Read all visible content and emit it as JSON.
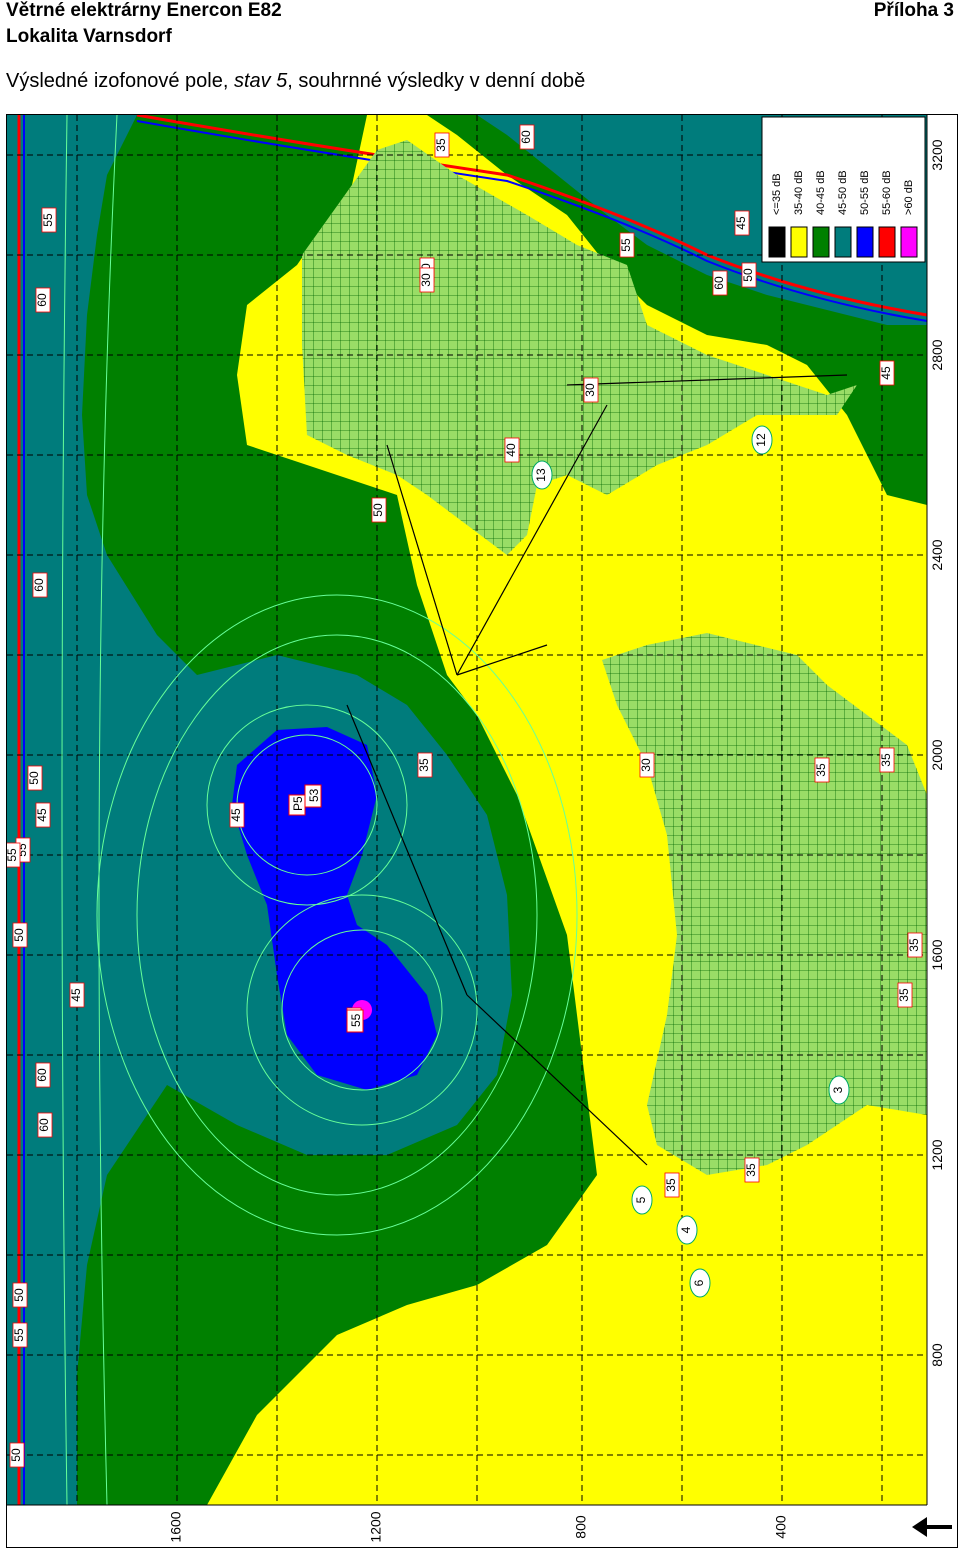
{
  "header": {
    "title_line1": "Větrné elektrárny Enercon E82",
    "title_line2": "Lokalita Varnsdorf",
    "appendix": "Příloha 3",
    "subtitle_prefix": "Výsledné izofonové pole, ",
    "subtitle_italic": "stav 5",
    "subtitle_suffix": ", souhrnné výsledky v denní době"
  },
  "legend": {
    "items": [
      {
        "label": "<=35 dB",
        "color": "#000000"
      },
      {
        "label": "35-40 dB",
        "color": "#ffff00"
      },
      {
        "label": "40-45 dB",
        "color": "#008000"
      },
      {
        "label": "45-50 dB",
        "color": "#007c7c"
      },
      {
        "label": "50-55 dB",
        "color": "#0000ff"
      },
      {
        "label": "55-60 dB",
        "color": "#ff0000"
      },
      {
        "label": ">60 dB",
        "color": "#ff00ff"
      }
    ]
  },
  "axes": {
    "right_ticks": [
      "3200",
      "2800",
      "2400",
      "2000",
      "1600",
      "1200",
      "800"
    ],
    "bottom_ticks": [
      "1600",
      "1200",
      "800",
      "400"
    ]
  },
  "contour_labels": [
    "35",
    "30",
    "60",
    "45",
    "60",
    "50",
    "30",
    "30",
    "40",
    "50",
    "60",
    "50",
    "45",
    "35",
    "30",
    "35",
    "35",
    "50",
    "45",
    "55",
    "55",
    "35",
    "35",
    "35",
    "35",
    "55",
    "60",
    "60",
    "50",
    "55",
    "50",
    "55",
    "60",
    "55",
    "45",
    "45"
  ],
  "receiver_points": [
    "12",
    "13",
    "3",
    "4",
    "5",
    "6"
  ],
  "turbine_labels": [
    "P5",
    "53",
    "55"
  ],
  "colors": {
    "yellow": "#ffff00",
    "green": "#008000",
    "teal": "#007c7c",
    "blue": "#0000ff",
    "forest": "#99dd66"
  }
}
